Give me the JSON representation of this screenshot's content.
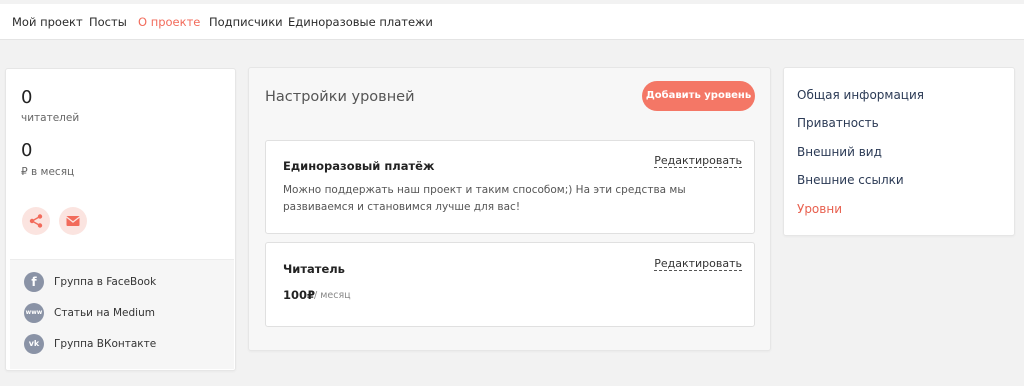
{
  "nav": {
    "items": [
      {
        "label": "Мой проект"
      },
      {
        "label": "Посты"
      },
      {
        "label": "О проекте"
      },
      {
        "label": "Подписчики"
      },
      {
        "label": "Единоразовые платежи"
      }
    ],
    "active_index": 2
  },
  "stats": {
    "readers_value": "0",
    "readers_label": "читателей",
    "monthly_value": "0",
    "monthly_label": "₽ в месяц"
  },
  "actions": {
    "share_icon": "share-icon",
    "mail_icon": "mail-icon"
  },
  "social_links": [
    {
      "icon": "f",
      "label": "Группа в FaceBook"
    },
    {
      "icon": "www",
      "label": "Статьи на Medium"
    },
    {
      "icon": "vk",
      "label": "Группа ВКонтакте"
    }
  ],
  "levels_panel": {
    "title": "Настройки уровней",
    "add_button": "Добавить уровень",
    "levels": [
      {
        "title": "Единоразовый платёж",
        "edit": "Редактировать",
        "description": "Можно поддержать наш проект и таким способом;) На эти средства мы развиваемся и становимся лучше для вас!"
      },
      {
        "title": "Читатель",
        "edit": "Редактировать",
        "price": "100₽",
        "period": "/ месяц"
      }
    ]
  },
  "settings_menu": {
    "items": [
      {
        "label": "Общая информация"
      },
      {
        "label": "Приватность"
      },
      {
        "label": "Внешний вид"
      },
      {
        "label": "Внешние ссылки"
      },
      {
        "label": "Уровни"
      }
    ],
    "active_index": 4
  },
  "colors": {
    "accent": "#f47766",
    "active_text": "#e8604f",
    "menu_text": "#2b3a55"
  }
}
